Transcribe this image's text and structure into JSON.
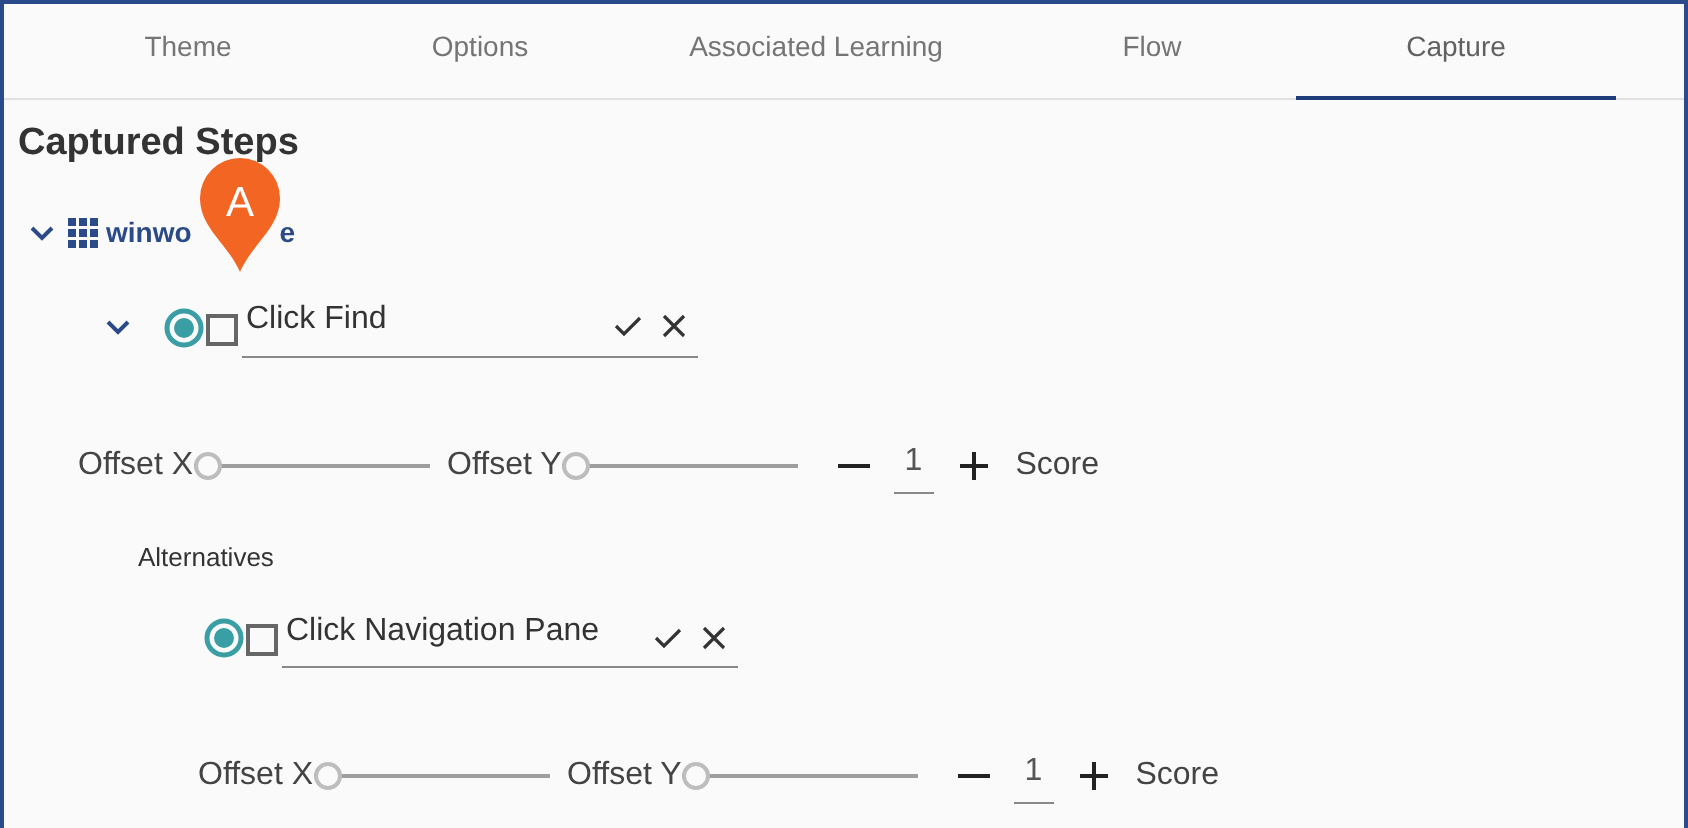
{
  "tabs": [
    {
      "label": "Theme",
      "selected": false
    },
    {
      "label": "Options",
      "selected": false
    },
    {
      "label": "Associated Learning",
      "selected": false
    },
    {
      "label": "Flow",
      "selected": false
    },
    {
      "label": "Capture",
      "selected": true
    }
  ],
  "heading": "Captured Steps",
  "tree": [
    {
      "label": "winwo",
      "label_end": "e",
      "expanded": true,
      "callout": "A",
      "steps": [
        {
          "name": "Click Find",
          "expanded": true,
          "selected": true,
          "checked": false,
          "offset_x": {
            "label": "Offset X",
            "level": 0
          },
          "offset_y": {
            "label": "Offset Y",
            "level": 0
          },
          "score_value": "1",
          "score_label": "Score",
          "alternatives_label": "Alternatives",
          "alternatives": [
            {
              "name": "Click Navigation Pane",
              "selected": true,
              "checked": false,
              "offset_x": {
                "label": "Offset X",
                "level": 0
              },
              "offset_y": {
                "label": "Offset Y",
                "level": 0
              },
              "score_value": "1",
              "score_label": "Score"
            }
          ]
        }
      ]
    }
  ]
}
